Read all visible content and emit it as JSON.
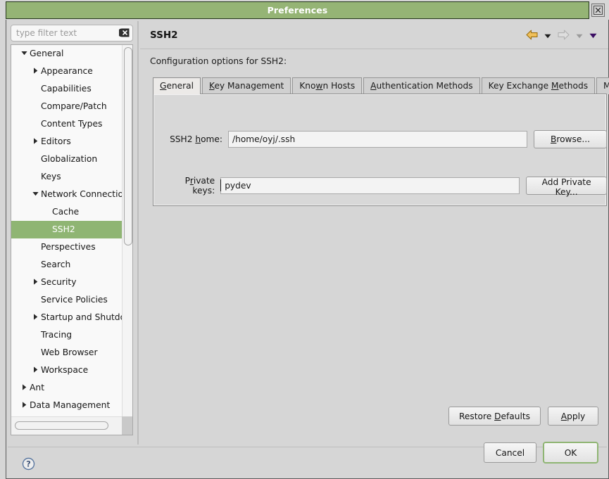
{
  "window": {
    "title": "Preferences",
    "close_icon": "close-icon"
  },
  "colors": {
    "titlebar_green": "#95b475",
    "selection_green": "#8fb573",
    "dialog_gray": "#d6d6d6",
    "ok_focus_green": "#8fb573",
    "back_arrow_gold": "#e8a93a",
    "purple_caret": "#4b1570",
    "help_blue": "#5a77a0"
  },
  "filter": {
    "placeholder": "type filter text",
    "value": "",
    "clear_icon": "clear-icon"
  },
  "tree": {
    "items": [
      {
        "label": "General",
        "level": 0,
        "twisty": "expanded",
        "selected": false
      },
      {
        "label": "Appearance",
        "level": 1,
        "twisty": "collapsed",
        "selected": false
      },
      {
        "label": "Capabilities",
        "level": 1,
        "twisty": "none",
        "selected": false
      },
      {
        "label": "Compare/Patch",
        "level": 1,
        "twisty": "none",
        "selected": false
      },
      {
        "label": "Content Types",
        "level": 1,
        "twisty": "none",
        "selected": false
      },
      {
        "label": "Editors",
        "level": 1,
        "twisty": "collapsed",
        "selected": false
      },
      {
        "label": "Globalization",
        "level": 1,
        "twisty": "none",
        "selected": false
      },
      {
        "label": "Keys",
        "level": 1,
        "twisty": "none",
        "selected": false
      },
      {
        "label": "Network Connections",
        "level": 1,
        "twisty": "expanded",
        "selected": false
      },
      {
        "label": "Cache",
        "level": 2,
        "twisty": "none",
        "selected": false
      },
      {
        "label": "SSH2",
        "level": 2,
        "twisty": "none",
        "selected": true
      },
      {
        "label": "Perspectives",
        "level": 1,
        "twisty": "none",
        "selected": false
      },
      {
        "label": "Search",
        "level": 1,
        "twisty": "none",
        "selected": false
      },
      {
        "label": "Security",
        "level": 1,
        "twisty": "collapsed",
        "selected": false
      },
      {
        "label": "Service Policies",
        "level": 1,
        "twisty": "none",
        "selected": false
      },
      {
        "label": "Startup and Shutdown",
        "level": 1,
        "twisty": "collapsed",
        "selected": false
      },
      {
        "label": "Tracing",
        "level": 1,
        "twisty": "none",
        "selected": false
      },
      {
        "label": "Web Browser",
        "level": 1,
        "twisty": "none",
        "selected": false
      },
      {
        "label": "Workspace",
        "level": 1,
        "twisty": "collapsed",
        "selected": false
      },
      {
        "label": "Ant",
        "level": 0,
        "twisty": "collapsed",
        "selected": false
      },
      {
        "label": "Data Management",
        "level": 0,
        "twisty": "collapsed",
        "selected": false
      }
    ]
  },
  "page": {
    "title": "SSH2",
    "description": "Configuration options for SSH2:"
  },
  "nav": {
    "back_icon": "back-arrow-icon",
    "back_menu_icon": "chevron-down-icon",
    "forward_icon": "forward-arrow-icon",
    "forward_menu_icon": "chevron-down-icon",
    "page_menu_icon": "chevron-down-icon"
  },
  "tabs": [
    {
      "label": "General",
      "mnemonic_index": 0,
      "active": true
    },
    {
      "label": "Key Management",
      "mnemonic_index": 0,
      "active": false
    },
    {
      "label": "Known Hosts",
      "mnemonic_index": 3,
      "active": false
    },
    {
      "label": "Authentication Methods",
      "mnemonic_index": 0,
      "active": false
    },
    {
      "label": "Key Exchange Methods",
      "mnemonic_index": 13,
      "active": false
    },
    {
      "label": "MAC Methods",
      "mnemonic_index": 2,
      "active": false
    }
  ],
  "form": {
    "ssh2_home": {
      "label": "SSH2 home:",
      "mnemonic_index": 5,
      "value": "/home/oyj/.ssh",
      "button": "Browse...",
      "button_mnemonic_index": 0
    },
    "private_keys": {
      "label": "Private keys:",
      "mnemonic_index": 1,
      "value": "pydev",
      "button": "Add Private Key...",
      "button_mnemonic_index": 11
    }
  },
  "actions": {
    "restore_defaults": "Restore Defaults",
    "restore_defaults_mnemonic_index": 8,
    "apply": "Apply",
    "apply_mnemonic_index": 0
  },
  "footer": {
    "help_icon": "help-icon",
    "cancel": "Cancel",
    "ok": "OK"
  }
}
